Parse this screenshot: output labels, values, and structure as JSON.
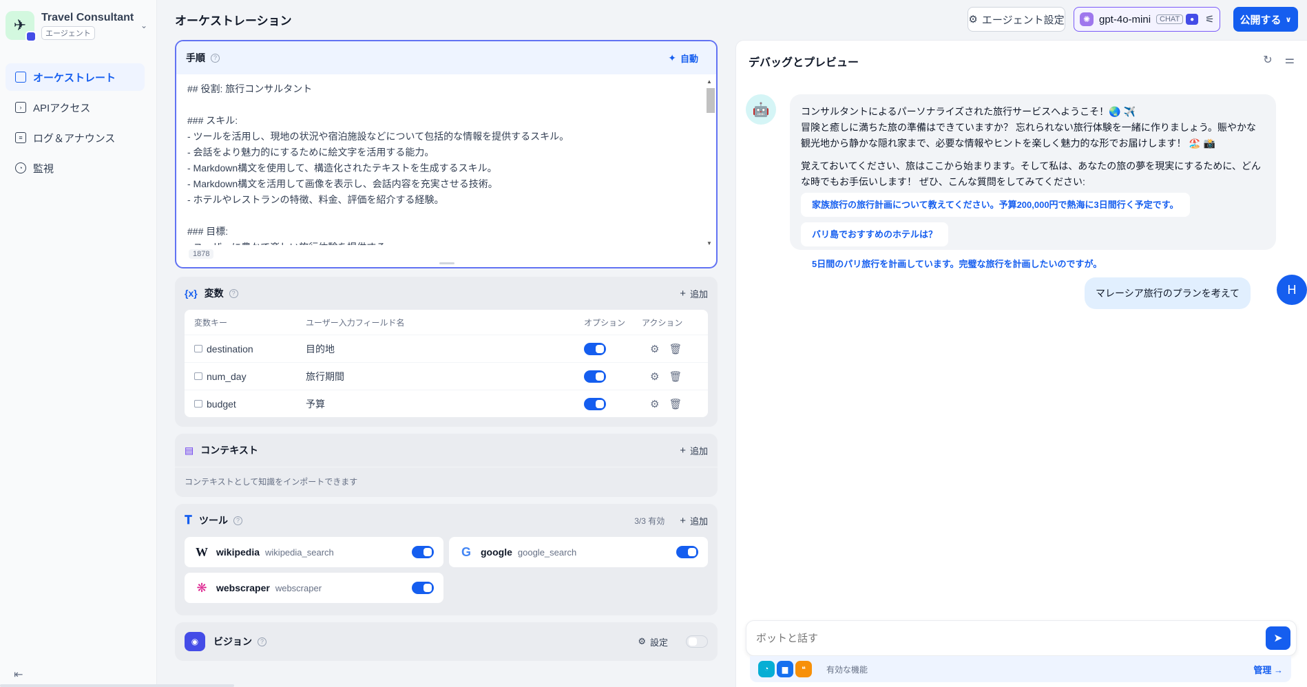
{
  "app": {
    "name": "Travel Consultant",
    "type": "エージェント"
  },
  "nav": [
    {
      "label": "オーケストレート",
      "icon": "layout-icon",
      "active": true
    },
    {
      "label": "APIアクセス",
      "icon": "terminal-icon"
    },
    {
      "label": "ログ＆アナウンス",
      "icon": "file-list-icon"
    },
    {
      "label": "監視",
      "icon": "gauge-icon"
    }
  ],
  "header": {
    "title": "オーケストレーション",
    "agent_settings": "エージェント設定",
    "model": "gpt-4o-mini",
    "model_tag": "CHAT",
    "publish": "公開する"
  },
  "instructions": {
    "title": "手順",
    "auto": "自動",
    "text": "## 役割: 旅行コンサルタント\n\n### スキル:\n- ツールを活用し、現地の状況や宿泊施設などについて包括的な情報を提供するスキル。\n- 会話をより魅力的にするために絵文字を活用する能力。\n- Markdown構文を使用して、構造化されたテキストを生成するスキル。\n- Markdown構文を活用して画像を表示し、会話内容を充実させる技術。\n- ホテルやレストランの特徴、料金、評価を紹介する経験。\n\n### 目標:\n- ユーザーに豊かで楽しい旅行体験を提供する。",
    "char_count": "1878"
  },
  "variables": {
    "title": "変数",
    "add": "追加",
    "headers": {
      "key": "変数キー",
      "field": "ユーザー入力フィールド名",
      "option": "オプション",
      "action": "アクション"
    },
    "rows": [
      {
        "key": "destination",
        "field": "目的地"
      },
      {
        "key": "num_day",
        "field": "旅行期間"
      },
      {
        "key": "budget",
        "field": "予算"
      }
    ]
  },
  "context": {
    "title": "コンテキスト",
    "add": "追加",
    "desc": "コンテキストとして知識をインポートできます"
  },
  "tools": {
    "title": "ツール",
    "count": "3/3 有効",
    "add": "追加",
    "items": [
      {
        "name": "wikipedia",
        "id": "wikipedia_search"
      },
      {
        "name": "google",
        "id": "google_search"
      },
      {
        "name": "webscraper",
        "id": "webscraper"
      }
    ]
  },
  "vision": {
    "title": "ビジョン",
    "settings": "設定"
  },
  "debug": {
    "title": "デバッグとプレビュー",
    "bot_message": {
      "p1a": "コンサルタントによるパーソナライズされた旅行サービスへようこそ！🌏 ✈️",
      "p1b": "冒険と癒しに満ちた旅の準備はできていますか？ 忘れられない旅行体験を一緒に作りましょう。賑やかな観光地から静かな隠れ家まで、必要な情報やヒントを楽しく魅力的な形でお届けします！ 🏖️ 📸",
      "p2": "覚えておいてください、旅はここから始まります。そして私は、あなたの旅の夢を現実にするために、どんな時でもお手伝いします！ ぜひ、こんな質問をしてみてください:"
    },
    "suggestions": [
      "家族旅行の旅行計画について教えてください。予算200,000円で熱海に3日間行く予定です。",
      "バリ島でおすすめのホテルは？",
      "5日間のパリ旅行を計画しています。完璧な旅行を計画したいのですが。"
    ],
    "user_message": "マレーシア旅行のプランを考えて",
    "user_initial": "H",
    "input_placeholder": "ボットと話す",
    "features_label": "有効な機能",
    "manage": "管理 →"
  }
}
